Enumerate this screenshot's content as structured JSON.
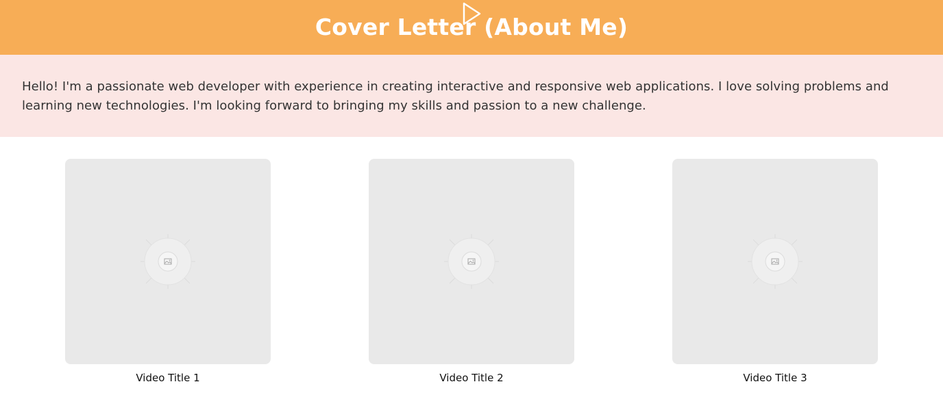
{
  "header": {
    "title": "Cover Letter (About Me)",
    "background": "#f7ad56",
    "text_color": "#ffffff",
    "icon": "play-icon"
  },
  "about": {
    "text": "Hello! I'm a passionate web developer with experience in creating interactive and responsive web applications. I love solving problems and learning new technologies. I'm looking forward to bringing my skills and passion to a new challenge.",
    "background": "#fbe6e4"
  },
  "videos": [
    {
      "title": "Video Title 1",
      "thumbnail_icon": "image-placeholder-icon"
    },
    {
      "title": "Video Title 2",
      "thumbnail_icon": "image-placeholder-icon"
    },
    {
      "title": "Video Title 3",
      "thumbnail_icon": "image-placeholder-icon"
    }
  ]
}
